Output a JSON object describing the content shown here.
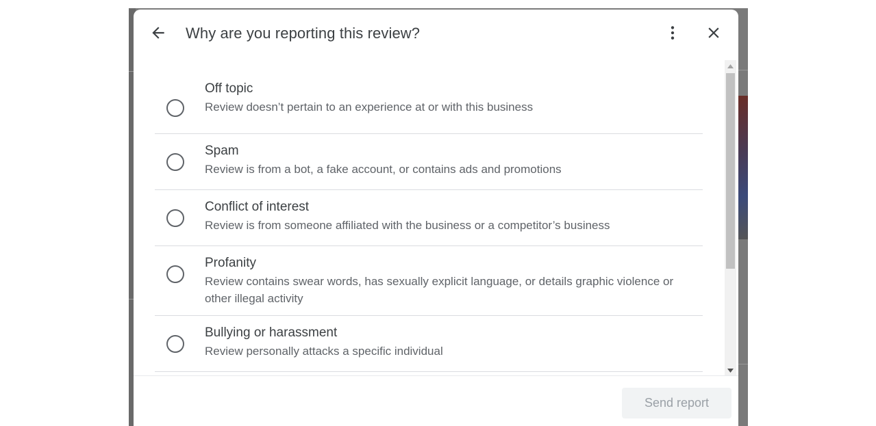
{
  "dialog": {
    "title": "Why are you reporting this review?",
    "back_icon": "arrow-back-icon",
    "more_icon": "more-vert-icon",
    "close_icon": "close-icon"
  },
  "options": [
    {
      "label": "Off topic",
      "description": "Review doesn’t pertain to an experience at or with this business",
      "selected": false
    },
    {
      "label": "Spam",
      "description": "Review is from a bot, a fake account, or contains ads and promotions",
      "selected": false
    },
    {
      "label": "Conflict of interest",
      "description": "Review is from someone affiliated with the business or a competitor’s business",
      "selected": false
    },
    {
      "label": "Profanity",
      "description": "Review contains swear words, has sexually explicit language, or details graphic violence or other illegal activity",
      "selected": false
    },
    {
      "label": "Bullying or harassment",
      "description": "Review personally attacks a specific individual",
      "selected": false
    }
  ],
  "footer": {
    "send_label": "Send report",
    "send_enabled": false
  },
  "colors": {
    "backdrop": "#7a7a7a",
    "text_primary": "#3c4043",
    "text_secondary": "#5f6368",
    "divider": "#dadce0",
    "button_disabled_bg": "#f1f3f4",
    "button_disabled_text": "#9aa0a6"
  }
}
